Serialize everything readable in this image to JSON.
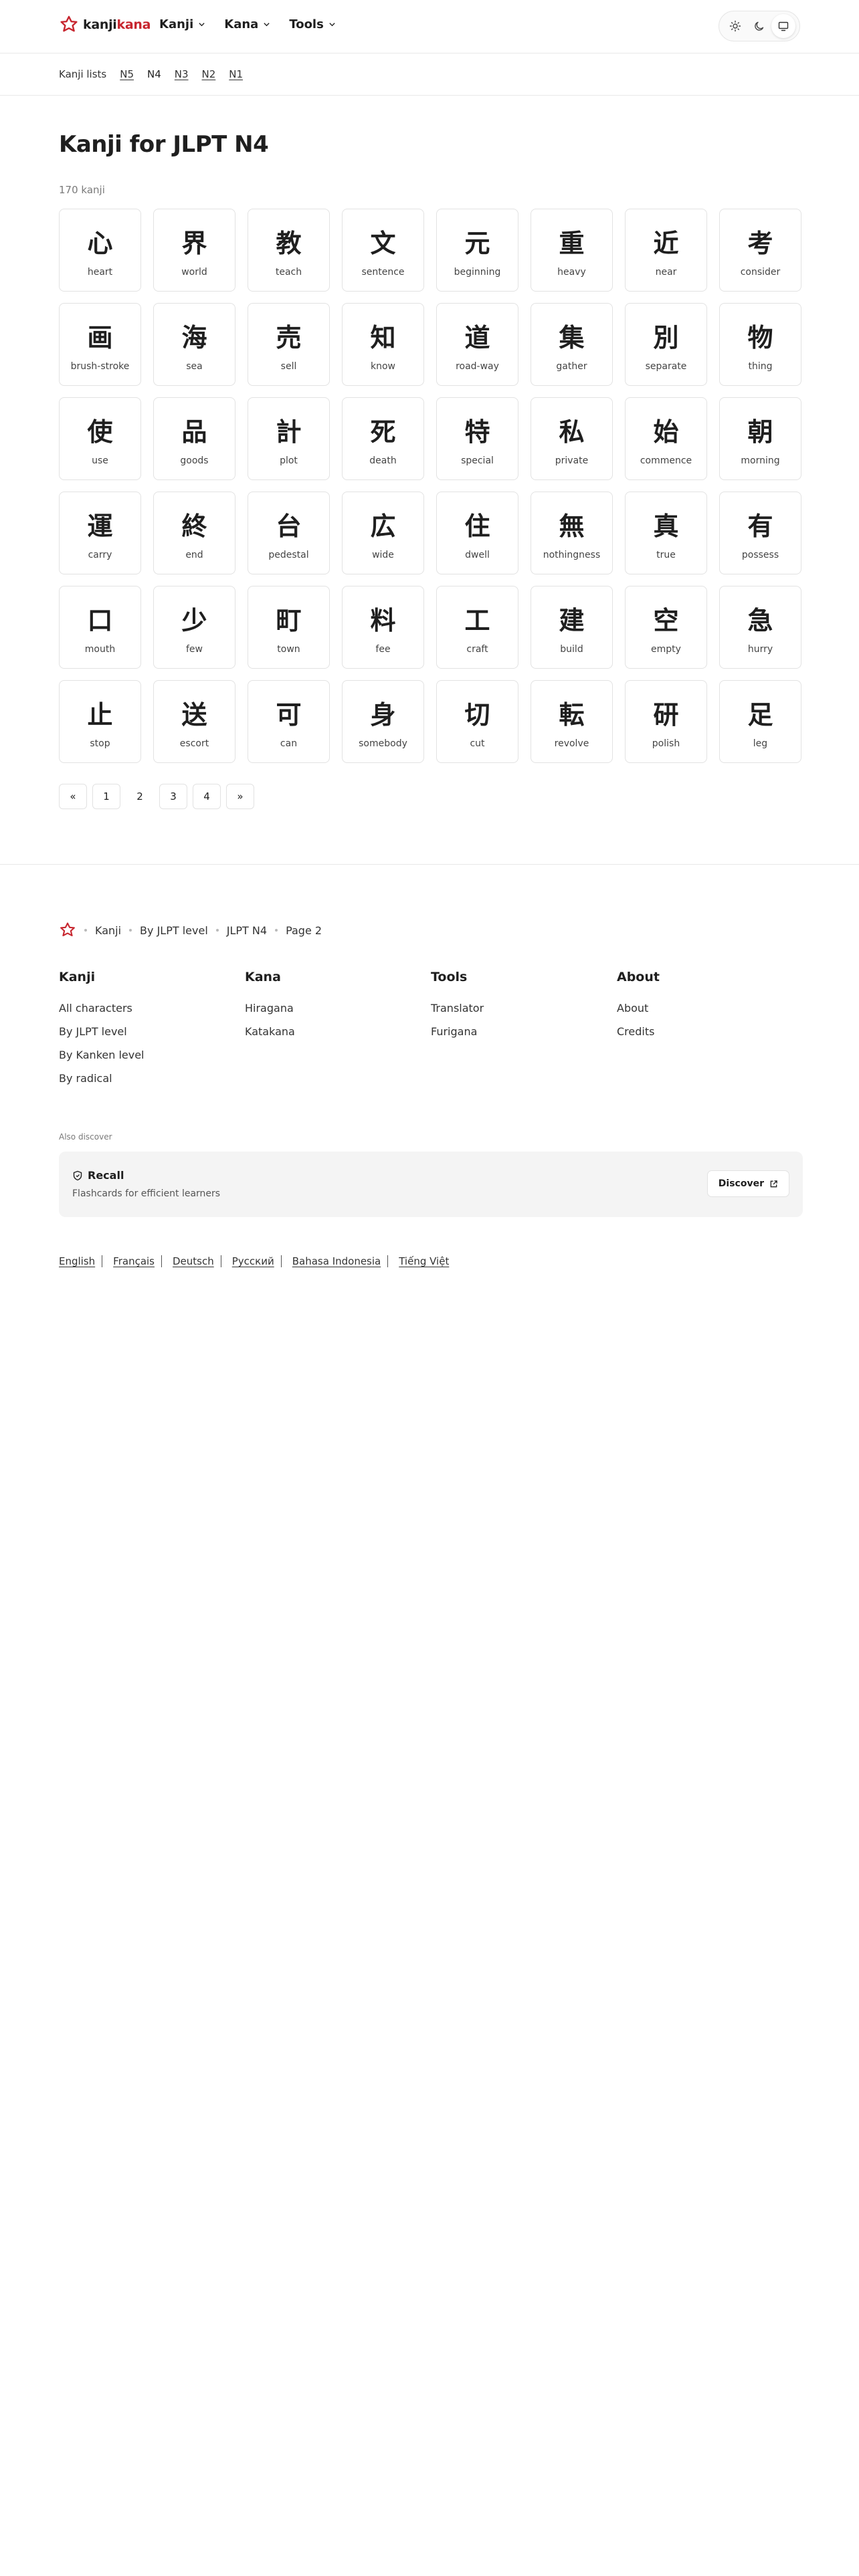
{
  "header": {
    "logo": {
      "part1": "kanji",
      "part2": "kana"
    },
    "nav": [
      {
        "label": "Kanji"
      },
      {
        "label": "Kana"
      },
      {
        "label": "Tools"
      }
    ],
    "theme_buttons": [
      "sun-icon",
      "moon-icon",
      "monitor-icon"
    ]
  },
  "subnav": {
    "label": "Kanji lists",
    "levels": [
      "N5",
      "N4",
      "N3",
      "N2",
      "N1"
    ],
    "current": "N4"
  },
  "main": {
    "title": "Kanji for JLPT N4",
    "count": "170 kanji",
    "kanji": [
      {
        "char": "心",
        "meaning": "heart"
      },
      {
        "char": "界",
        "meaning": "world"
      },
      {
        "char": "教",
        "meaning": "teach"
      },
      {
        "char": "文",
        "meaning": "sentence"
      },
      {
        "char": "元",
        "meaning": "beginning"
      },
      {
        "char": "重",
        "meaning": "heavy"
      },
      {
        "char": "近",
        "meaning": "near"
      },
      {
        "char": "考",
        "meaning": "consider"
      },
      {
        "char": "画",
        "meaning": "brush-stroke"
      },
      {
        "char": "海",
        "meaning": "sea"
      },
      {
        "char": "売",
        "meaning": "sell"
      },
      {
        "char": "知",
        "meaning": "know"
      },
      {
        "char": "道",
        "meaning": "road-way"
      },
      {
        "char": "集",
        "meaning": "gather"
      },
      {
        "char": "別",
        "meaning": "separate"
      },
      {
        "char": "物",
        "meaning": "thing"
      },
      {
        "char": "使",
        "meaning": "use"
      },
      {
        "char": "品",
        "meaning": "goods"
      },
      {
        "char": "計",
        "meaning": "plot"
      },
      {
        "char": "死",
        "meaning": "death"
      },
      {
        "char": "特",
        "meaning": "special"
      },
      {
        "char": "私",
        "meaning": "private"
      },
      {
        "char": "始",
        "meaning": "commence"
      },
      {
        "char": "朝",
        "meaning": "morning"
      },
      {
        "char": "運",
        "meaning": "carry"
      },
      {
        "char": "終",
        "meaning": "end"
      },
      {
        "char": "台",
        "meaning": "pedestal"
      },
      {
        "char": "広",
        "meaning": "wide"
      },
      {
        "char": "住",
        "meaning": "dwell"
      },
      {
        "char": "無",
        "meaning": "nothingness"
      },
      {
        "char": "真",
        "meaning": "true"
      },
      {
        "char": "有",
        "meaning": "possess"
      },
      {
        "char": "口",
        "meaning": "mouth"
      },
      {
        "char": "少",
        "meaning": "few"
      },
      {
        "char": "町",
        "meaning": "town"
      },
      {
        "char": "料",
        "meaning": "fee"
      },
      {
        "char": "工",
        "meaning": "craft"
      },
      {
        "char": "建",
        "meaning": "build"
      },
      {
        "char": "空",
        "meaning": "empty"
      },
      {
        "char": "急",
        "meaning": "hurry"
      },
      {
        "char": "止",
        "meaning": "stop"
      },
      {
        "char": "送",
        "meaning": "escort"
      },
      {
        "char": "可",
        "meaning": "can"
      },
      {
        "char": "身",
        "meaning": "somebody"
      },
      {
        "char": "切",
        "meaning": "cut"
      },
      {
        "char": "転",
        "meaning": "revolve"
      },
      {
        "char": "研",
        "meaning": "polish"
      },
      {
        "char": "足",
        "meaning": "leg"
      }
    ],
    "pagination": {
      "prev": "«",
      "pages": [
        "1",
        "2",
        "3",
        "4"
      ],
      "current": "2",
      "next": "»"
    }
  },
  "footer": {
    "breadcrumb": [
      "Kanji",
      "By JLPT level",
      "JLPT N4",
      "Page 2"
    ],
    "columns": [
      {
        "title": "Kanji",
        "links": [
          "All characters",
          "By JLPT level",
          "By Kanken level",
          "By radical"
        ]
      },
      {
        "title": "Kana",
        "links": [
          "Hiragana",
          "Katakana"
        ]
      },
      {
        "title": "Tools",
        "links": [
          "Translator",
          "Furigana"
        ]
      },
      {
        "title": "About",
        "links": [
          "About",
          "Credits"
        ]
      }
    ],
    "also_discover": "Also discover",
    "promo": {
      "title": "Recall",
      "subtitle": "Flashcards for efficient learners",
      "button": "Discover"
    },
    "languages": [
      "English",
      "Français",
      "Deutsch",
      "Русский",
      "Bahasa Indonesia",
      "Tiếng Việt"
    ]
  },
  "colors": {
    "brand": "#c7252e",
    "border": "#e2e2e2",
    "muted": "#7a7a7a"
  }
}
